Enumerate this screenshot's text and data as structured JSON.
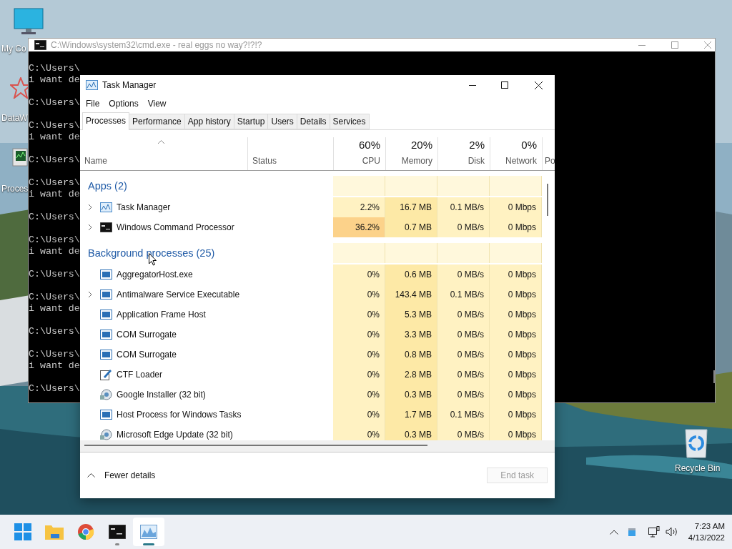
{
  "desktop_icons": [
    {
      "label": "My Co",
      "kind": "computer"
    },
    {
      "label": "DataW",
      "kind": "wolfram"
    },
    {
      "label": "Proces",
      "kind": "monitor"
    },
    {
      "label": "Recycle Bin",
      "kind": "recycle"
    }
  ],
  "cmd_window": {
    "title": "C:\\Windows\\system32\\cmd.exe - real  eggs no way?!?!?",
    "blocks": [
      [
        "C:\\Users\\",
        "i want de"
      ],
      [
        "C:\\Users\\"
      ],
      [
        "C:\\Users\\",
        "i want de"
      ],
      [
        "C:\\Users\\"
      ],
      [
        "C:\\Users\\",
        "i want de"
      ],
      [
        "C:\\Users\\"
      ],
      [
        "C:\\Users\\",
        "i want de"
      ],
      [
        "C:\\Users\\"
      ],
      [
        "C:\\Users\\",
        "i want de"
      ],
      [
        "C:\\Users\\"
      ],
      [
        "C:\\Users\\",
        "i want de"
      ],
      [
        "C:\\Users\\"
      ]
    ]
  },
  "task_manager": {
    "title": "Task Manager",
    "menu": [
      "File",
      "Options",
      "View"
    ],
    "tabs": [
      {
        "label": "Processes",
        "selected": true
      },
      {
        "label": "Performance",
        "selected": false
      },
      {
        "label": "App history",
        "selected": false
      },
      {
        "label": "Startup",
        "selected": false
      },
      {
        "label": "Users",
        "selected": false
      },
      {
        "label": "Details",
        "selected": false
      },
      {
        "label": "Services",
        "selected": false
      }
    ],
    "columns": [
      {
        "label": "Name"
      },
      {
        "label": "Status"
      },
      {
        "total": "60%",
        "label": "CPU"
      },
      {
        "total": "20%",
        "label": "Memory"
      },
      {
        "total": "2%",
        "label": "Disk"
      },
      {
        "total": "0%",
        "label": "Network"
      },
      {
        "label": "Po"
      }
    ],
    "groups": [
      {
        "title": "Apps (2)",
        "rows": [
          {
            "name": "Task Manager",
            "kind": "taskmgr",
            "expandable": true,
            "cpu_high": false,
            "cpu": "2.2%",
            "memory": "16.7 MB",
            "disk": "0.1 MB/s",
            "network": "0 Mbps"
          },
          {
            "name": "Windows Command Processor",
            "kind": "cmd",
            "expandable": true,
            "cpu_high": true,
            "cpu": "36.2%",
            "memory": "0.7 MB",
            "disk": "0 MB/s",
            "network": "0 Mbps"
          }
        ]
      },
      {
        "title": "Background processes (25)",
        "rows": [
          {
            "name": "AggregatorHost.exe",
            "kind": "app",
            "expandable": false,
            "cpu_high": false,
            "cpu": "0%",
            "memory": "0.6 MB",
            "disk": "0 MB/s",
            "network": "0 Mbps"
          },
          {
            "name": "Antimalware Service Executable",
            "kind": "app",
            "expandable": true,
            "cpu_high": false,
            "cpu": "0%",
            "memory": "143.4 MB",
            "disk": "0.1 MB/s",
            "network": "0 Mbps"
          },
          {
            "name": "Application Frame Host",
            "kind": "app",
            "expandable": false,
            "cpu_high": false,
            "cpu": "0%",
            "memory": "5.3 MB",
            "disk": "0 MB/s",
            "network": "0 Mbps"
          },
          {
            "name": "COM Surrogate",
            "kind": "app",
            "expandable": false,
            "cpu_high": false,
            "cpu": "0%",
            "memory": "3.3 MB",
            "disk": "0 MB/s",
            "network": "0 Mbps"
          },
          {
            "name": "COM Surrogate",
            "kind": "app",
            "expandable": false,
            "cpu_high": false,
            "cpu": "0%",
            "memory": "0.8 MB",
            "disk": "0 MB/s",
            "network": "0 Mbps"
          },
          {
            "name": "CTF Loader",
            "kind": "pen",
            "expandable": false,
            "cpu_high": false,
            "cpu": "0%",
            "memory": "2.8 MB",
            "disk": "0 MB/s",
            "network": "0 Mbps"
          },
          {
            "name": "Google Installer (32 bit)",
            "kind": "installer",
            "expandable": false,
            "cpu_high": false,
            "cpu": "0%",
            "memory": "0.3 MB",
            "disk": "0 MB/s",
            "network": "0 Mbps"
          },
          {
            "name": "Host Process for Windows Tasks",
            "kind": "app",
            "expandable": false,
            "cpu_high": false,
            "cpu": "0%",
            "memory": "1.7 MB",
            "disk": "0.1 MB/s",
            "network": "0 Mbps"
          },
          {
            "name": "Microsoft Edge Update (32 bit)",
            "kind": "installer",
            "expandable": false,
            "cpu_high": false,
            "cpu": "0%",
            "memory": "0.3 MB",
            "disk": "0 MB/s",
            "network": "0 Mbps"
          }
        ]
      }
    ],
    "fewer_details": "Fewer details",
    "end_task": {
      "label": "End task",
      "disabled": true
    }
  },
  "taskbar": {
    "apps": [
      {
        "kind": "start",
        "running": false,
        "active": false
      },
      {
        "kind": "folder",
        "running": false,
        "active": false
      },
      {
        "kind": "chrome",
        "running": false,
        "active": false
      },
      {
        "kind": "cmd",
        "running": true,
        "active": false
      },
      {
        "kind": "taskmgr",
        "running": true,
        "active": true
      }
    ],
    "time": "7:23 AM",
    "date": "4/13/2022"
  }
}
